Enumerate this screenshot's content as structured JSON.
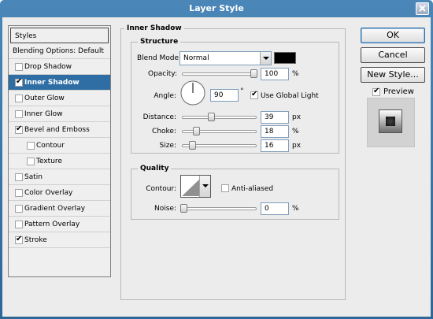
{
  "window": {
    "title": "Layer Style"
  },
  "sidebar": {
    "header": "Styles",
    "items": [
      {
        "label": "Blending Options: Default",
        "kind": "header"
      },
      {
        "label": "Drop Shadow",
        "checked": false,
        "kind": "check"
      },
      {
        "label": "Inner Shadow",
        "checked": true,
        "kind": "check",
        "selected": true
      },
      {
        "label": "Outer Glow",
        "checked": false,
        "kind": "check"
      },
      {
        "label": "Inner Glow",
        "checked": false,
        "kind": "check"
      },
      {
        "label": "Bevel and Emboss",
        "checked": true,
        "kind": "check"
      },
      {
        "label": "Contour",
        "checked": false,
        "kind": "sub"
      },
      {
        "label": "Texture",
        "checked": false,
        "kind": "sub"
      },
      {
        "label": "Satin",
        "checked": false,
        "kind": "check"
      },
      {
        "label": "Color Overlay",
        "checked": false,
        "kind": "check"
      },
      {
        "label": "Gradient Overlay",
        "checked": false,
        "kind": "check"
      },
      {
        "label": "Pattern Overlay",
        "checked": false,
        "kind": "check"
      },
      {
        "label": "Stroke",
        "checked": true,
        "kind": "check"
      }
    ]
  },
  "inner_shadow": {
    "title": "Inner Shadow",
    "structure": {
      "title": "Structure",
      "blend_mode_label": "Blend Mode:",
      "blend_mode_value": "Normal",
      "shadow_color": "#000000",
      "opacity_label": "Opacity:",
      "opacity_value": "100",
      "opacity_unit": "%",
      "angle_label": "Angle:",
      "angle_value": "90",
      "angle_unit": "°",
      "global_light_label": "Use Global Light",
      "global_light_checked": true,
      "distance_label": "Distance:",
      "distance_value": "39",
      "distance_unit": "px",
      "choke_label": "Choke:",
      "choke_value": "18",
      "choke_unit": "%",
      "size_label": "Size:",
      "size_value": "16",
      "size_unit": "px"
    },
    "quality": {
      "title": "Quality",
      "contour_label": "Contour:",
      "anti_aliased_label": "Anti-aliased",
      "anti_aliased_checked": false,
      "noise_label": "Noise:",
      "noise_value": "0",
      "noise_unit": "%"
    }
  },
  "buttons": {
    "ok": "OK",
    "cancel": "Cancel",
    "new_style": "New Style...",
    "preview_label": "Preview",
    "preview_checked": true
  }
}
